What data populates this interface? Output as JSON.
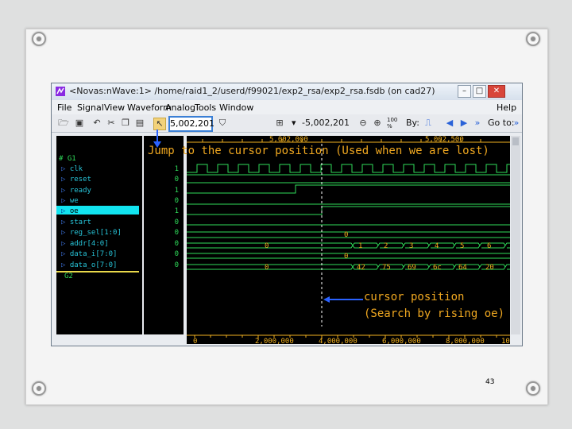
{
  "window": {
    "title": "<Novas:nWave:1> /home/raid1_2/userd/f99021/exp2_rsa/exp2_rsa.fsdb (on cad27)",
    "controls": {
      "minimize": "–",
      "maximize": "□",
      "close": "✕"
    }
  },
  "menu": [
    "File",
    "Signal",
    "View",
    "Waveform",
    "Analog",
    "Tools",
    "Window"
  ],
  "help": "Help",
  "toolbar": {
    "cursor_time": "5,002,201",
    "delta_value": "-5,002,201",
    "zoom_label": "100\n%",
    "by_label": "By:",
    "goto_label": "Go to:"
  },
  "top_ruler": {
    "left_label": "5,002,000",
    "right_label": "5,002,500"
  },
  "signals": {
    "group1": "# G1",
    "group2": "G2",
    "names": [
      "clk",
      "reset",
      "ready",
      "we",
      "oe",
      "start",
      "reg_sel[1:0]",
      "addr[4:0]",
      "data_i[7:0]",
      "data_o[7:0]"
    ],
    "values": [
      "1",
      "0",
      "1",
      "0",
      "1",
      "0",
      "0",
      "0",
      "0",
      "0"
    ],
    "selected": "oe"
  },
  "waves": {
    "reg_sel": [
      "0"
    ],
    "addr": [
      "0",
      "1",
      "2",
      "3",
      "4",
      "5",
      "6"
    ],
    "data_i": [
      "0"
    ],
    "data_o": [
      "0",
      "42",
      "75",
      "69",
      "6c",
      "64",
      "20"
    ]
  },
  "bottom_ruler": [
    "0",
    "2,000,000",
    "4,000,000",
    "6,000,000",
    "8,000,000",
    "10"
  ],
  "annotations": {
    "jump": "Jump to the cursor position (Used when we are lost)",
    "cursor1": "cursor position",
    "cursor2": "(Search by rising oe)"
  },
  "page_number": "43",
  "colors": {
    "wave_green": "#2fdc5a",
    "signal_cyan": "#27c4d8",
    "annotation": "#f0a820",
    "highlight": "#12e4f0"
  }
}
